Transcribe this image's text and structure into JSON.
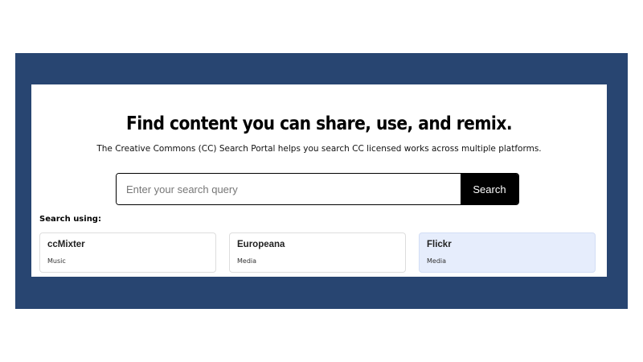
{
  "header": {
    "title": "Find content you can share, use, and remix.",
    "subtitle": "The Creative Commons (CC) Search Portal helps you search CC licensed works across multiple platforms."
  },
  "search": {
    "placeholder": "Enter your search query",
    "value": "",
    "button_label": "Search"
  },
  "sources": {
    "label": "Search using:",
    "items": [
      {
        "name": "ccMixter",
        "category": "Music",
        "selected": false
      },
      {
        "name": "Europeana",
        "category": "Media",
        "selected": false
      },
      {
        "name": "Flickr",
        "category": "Media",
        "selected": true
      }
    ]
  },
  "colors": {
    "frame": "#284571",
    "selected_card": "#e6edfc"
  }
}
